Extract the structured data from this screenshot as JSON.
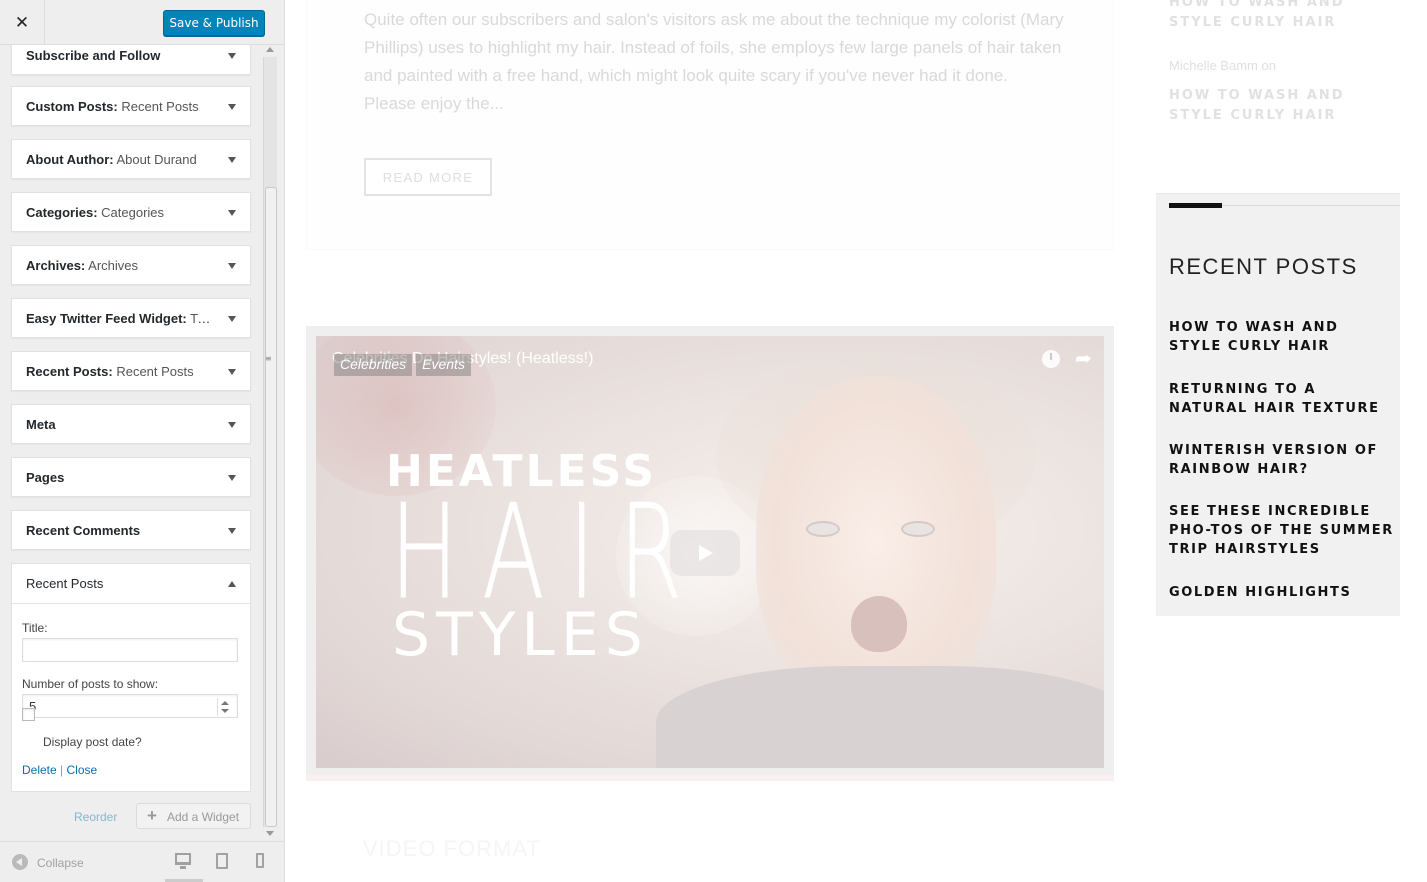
{
  "customizer": {
    "close_icon": "close-icon",
    "save_label": "Save & Publish",
    "widgets": [
      {
        "type": "Subscribe and Follow",
        "name": ""
      },
      {
        "type": "Custom Posts:",
        "name": "Recent Posts"
      },
      {
        "type": "About Author:",
        "name": "About Durand"
      },
      {
        "type": "Categories:",
        "name": "Categories"
      },
      {
        "type": "Archives:",
        "name": "Archives"
      },
      {
        "type": "Easy Twitter Feed Widget:",
        "name": "Twi..."
      },
      {
        "type": "Recent Posts:",
        "name": "Recent Posts"
      },
      {
        "type": "Meta",
        "name": ""
      },
      {
        "type": "Pages",
        "name": ""
      },
      {
        "type": "Recent Comments",
        "name": ""
      }
    ],
    "expanded_widget": {
      "type": "Recent Posts",
      "title_label": "Title:",
      "title_value": "",
      "number_label": "Number of posts to show:",
      "number_value": "5",
      "display_date_label": "Display post date?",
      "display_date_checked": false,
      "delete_label": "Delete",
      "separator": "|",
      "close_label": "Close"
    },
    "reorder_label": "Reorder",
    "add_widget_label": "Add a Widget",
    "footer": {
      "collapse_label": "Collapse",
      "devices": [
        "desktop-icon",
        "tablet-icon",
        "mobile-icon"
      ],
      "active_device": "desktop"
    }
  },
  "preview": {
    "excerpt": "Quite often our subscribers and salon's visitors ask me about the technique my colorist (Mary Phillips) uses to highlight my hair. Instead of foils, she employs few large panels of hair taken and painted with a free hand, which might look quite scary if you've never had it done. Please enjoy the...",
    "read_more_label": "READ MORE",
    "video": {
      "title": "Celebrities Do Hairstyles! (Heatless!)",
      "categories": [
        "Celebrities",
        "Events"
      ],
      "overlay_line1": "HEATLESS",
      "overlay_line2": "HAIR",
      "overlay_line3": "STYLES",
      "clock_icon": "clock-icon",
      "share_icon": "share-icon",
      "play_icon": "play-icon"
    },
    "next_post_title": "VIDEO FORMAT",
    "sidebar": {
      "comments": {
        "first_title": "HOW TO WASH AND STYLE CURLY HAIR",
        "commenter": "Michelle Bamm on",
        "second_title": "HOW TO WASH AND STYLE CURLY HAIR"
      },
      "recent_posts": {
        "title": "RECENT POSTS",
        "items": [
          "HOW TO WASH AND STYLE CURLY HAIR",
          "RETURNING TO A NATURAL HAIR TEXTURE",
          "WINTERISH VERSION OF RAINBOW HAIR?",
          "SEE THESE INCREDIBLE PHO-TOS OF THE SUMMER TRIP HAIRSTYLES",
          "GOLDEN HIGHLIGHTS"
        ]
      }
    }
  },
  "colors": {
    "primary_button": "#0085ba",
    "link": "#0073aa",
    "sidebar_bg": "#eeeeee",
    "widget_accent": "#111111"
  }
}
